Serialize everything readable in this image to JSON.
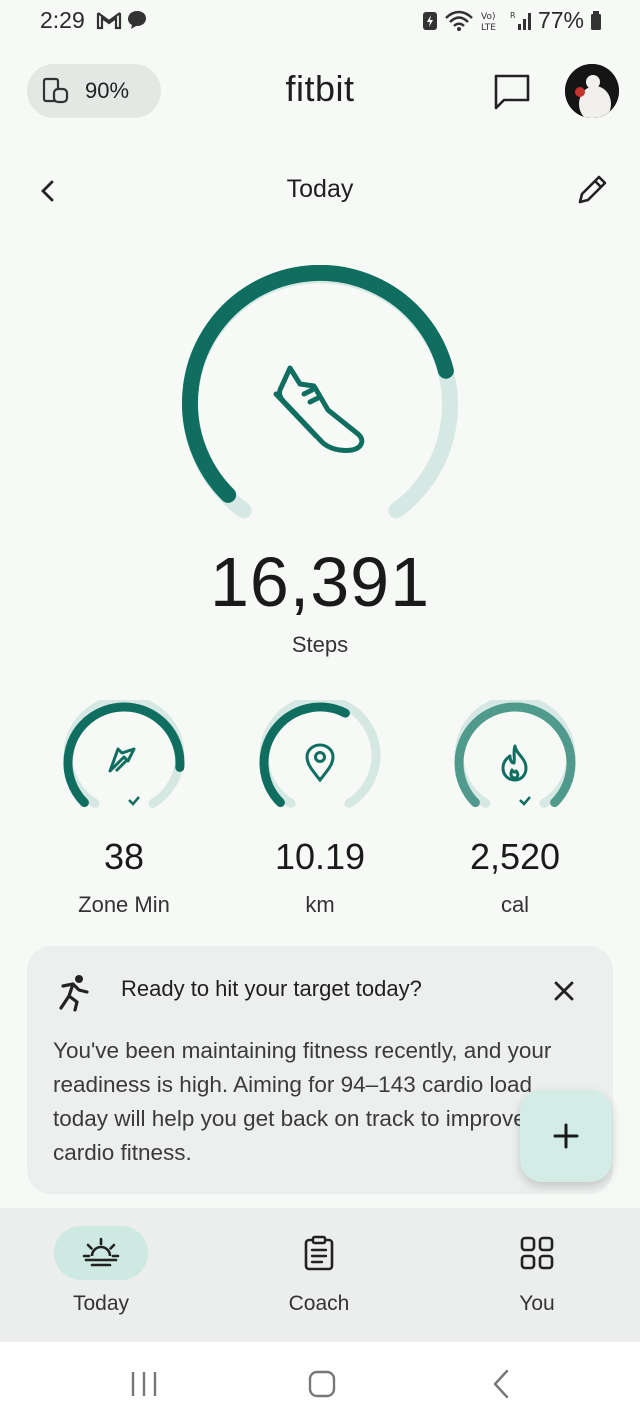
{
  "status_bar": {
    "time": "2:29",
    "battery": "77%"
  },
  "header": {
    "device_battery": "90%",
    "app_title": "fitbit"
  },
  "page": {
    "title": "Today"
  },
  "main_stat": {
    "value": "16,391",
    "label": "Steps",
    "progress": 0.78
  },
  "stats": [
    {
      "value": "38",
      "label": "Zone Min",
      "progress": 0.85,
      "goal_met": true
    },
    {
      "value": "10.19",
      "label": "km",
      "progress": 0.6,
      "goal_met": false
    },
    {
      "value": "2,520",
      "label": "cal",
      "progress": 1.0,
      "goal_met": true
    }
  ],
  "card": {
    "title": "Ready to hit your target today?",
    "body": "You've been maintaining fitness recently, and your readiness is high. Aiming for 94–143 cardio load today will help you get back on track to improve your cardio fitness."
  },
  "nav": [
    {
      "label": "Today",
      "active": true
    },
    {
      "label": "Coach",
      "active": false
    },
    {
      "label": "You",
      "active": false
    }
  ],
  "colors": {
    "accent": "#0f6e5f",
    "accent_light": "#d6e8e3",
    "fab_bg": "#d4ece6"
  }
}
